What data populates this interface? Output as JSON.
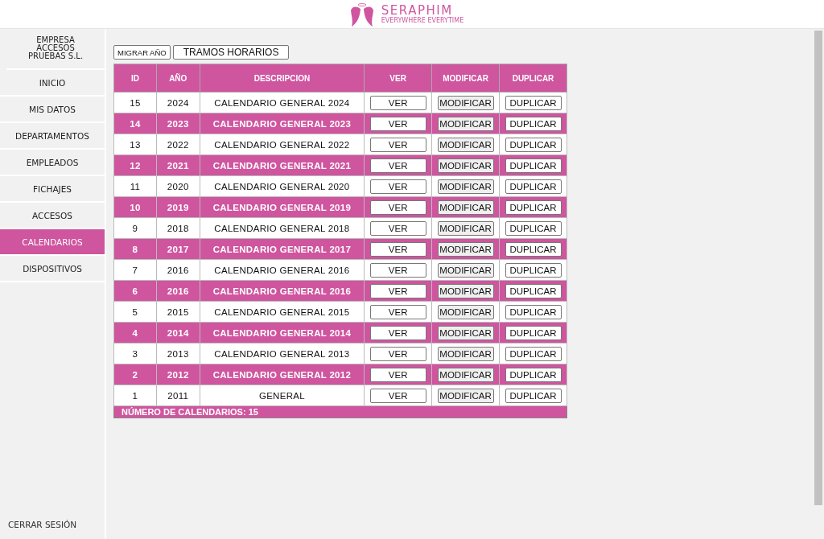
{
  "header": {
    "brand": "SERAPHIM",
    "tagline": "EVERYWHERE EVERYTIME"
  },
  "sidebar": {
    "company": "EMPRESA ACCESOS PRUEBAS S.L.",
    "items": [
      {
        "label": "INICIO",
        "selected": false
      },
      {
        "label": "MIS DATOS",
        "selected": false
      },
      {
        "label": "DEPARTAMENTOS",
        "selected": false
      },
      {
        "label": "EMPLEADOS",
        "selected": false
      },
      {
        "label": "FICHAJES",
        "selected": false
      },
      {
        "label": "ACCESOS",
        "selected": false
      },
      {
        "label": "CALENDARIOS",
        "selected": true
      },
      {
        "label": "DISPOSITIVOS",
        "selected": false
      }
    ],
    "logout": "CERRAR SESIÓN"
  },
  "toolbar": [
    "MIGRAR AÑO",
    "TRAMOS HORARIOS"
  ],
  "table": {
    "columns": [
      "ID",
      "AÑO",
      "DESCRIPCION",
      "VER",
      "MODIFICAR",
      "DUPLICAR"
    ],
    "rows": [
      {
        "id": "15",
        "year": "2024",
        "description": "CALENDARIO GENERAL 2024",
        "actions": [
          "VER",
          "MODIFICAR",
          "DUPLICAR"
        ]
      },
      {
        "id": "14",
        "year": "2023",
        "description": "CALENDARIO GENERAL 2023",
        "actions": [
          "VER",
          "MODIFICAR",
          "DUPLICAR"
        ]
      },
      {
        "id": "13",
        "year": "2022",
        "description": "CALENDARIO GENERAL 2022",
        "actions": [
          "VER",
          "MODIFICAR",
          "DUPLICAR"
        ]
      },
      {
        "id": "12",
        "year": "2021",
        "description": "CALENDARIO GENERAL 2021",
        "actions": [
          "VER",
          "MODIFICAR",
          "DUPLICAR"
        ]
      },
      {
        "id": "11",
        "year": "2020",
        "description": "CALENDARIO GENERAL 2020",
        "actions": [
          "VER",
          "MODIFICAR",
          "DUPLICAR"
        ]
      },
      {
        "id": "10",
        "year": "2019",
        "description": "CALENDARIO GENERAL 2019",
        "actions": [
          "VER",
          "MODIFICAR",
          "DUPLICAR"
        ]
      },
      {
        "id": "9",
        "year": "2018",
        "description": "CALENDARIO GENERAL 2018",
        "actions": [
          "VER",
          "MODIFICAR",
          "DUPLICAR"
        ]
      },
      {
        "id": "8",
        "year": "2017",
        "description": "CALENDARIO GENERAL 2017",
        "actions": [
          "VER",
          "MODIFICAR",
          "DUPLICAR"
        ]
      },
      {
        "id": "7",
        "year": "2016",
        "description": "CALENDARIO GENERAL 2016",
        "actions": [
          "VER",
          "MODIFICAR",
          "DUPLICAR"
        ]
      },
      {
        "id": "6",
        "year": "2016",
        "description": "CALENDARIO GENERAL 2016",
        "actions": [
          "VER",
          "MODIFICAR",
          "DUPLICAR"
        ]
      },
      {
        "id": "5",
        "year": "2015",
        "description": "CALENDARIO GENERAL 2015",
        "actions": [
          "VER",
          "MODIFICAR",
          "DUPLICAR"
        ]
      },
      {
        "id": "4",
        "year": "2014",
        "description": "CALENDARIO GENERAL 2014",
        "actions": [
          "VER",
          "MODIFICAR",
          "DUPLICAR"
        ]
      },
      {
        "id": "3",
        "year": "2013",
        "description": "CALENDARIO GENERAL 2013",
        "actions": [
          "VER",
          "MODIFICAR",
          "DUPLICAR"
        ]
      },
      {
        "id": "2",
        "year": "2012",
        "description": "CALENDARIO GENERAL 2012",
        "actions": [
          "VER",
          "MODIFICAR",
          "DUPLICAR"
        ]
      },
      {
        "id": "1",
        "year": "2011",
        "description": "GENERAL",
        "actions": [
          "VER",
          "MODIFICAR",
          "DUPLICAR"
        ]
      }
    ],
    "footer": "NÚMERO DE CALENDARIOS: 15"
  }
}
